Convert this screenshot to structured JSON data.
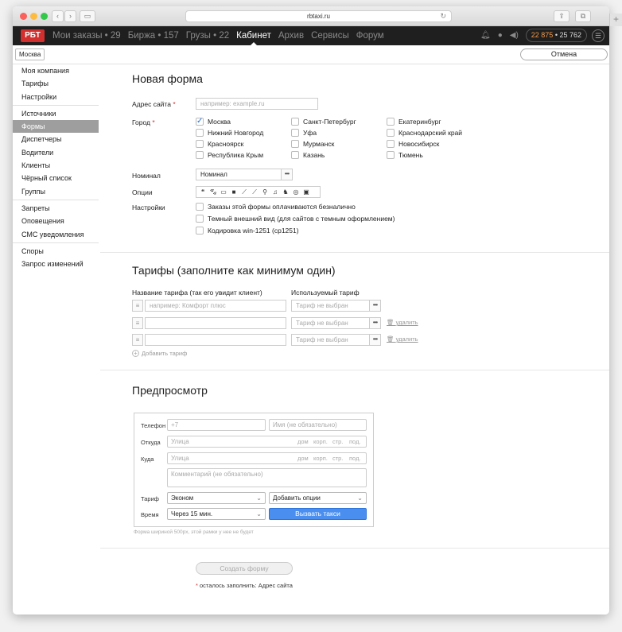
{
  "browser": {
    "url": "rbtaxi.ru",
    "new_tab": "+"
  },
  "topnav": {
    "logo": "РБТ",
    "items": [
      "Мои заказы • 29",
      "Биржа • 157",
      "Грузы • 22",
      "Кабинет",
      "Архив",
      "Сервисы",
      "Форум"
    ],
    "active_index": 3,
    "balance_a": "22 875",
    "balance_sep": " • ",
    "balance_b": "25 762"
  },
  "subbar": {
    "city": "Москва",
    "cancel": "Отмена"
  },
  "sidebar": {
    "group1": [
      "Моя компания",
      "Тарифы",
      "Настройки"
    ],
    "group2": [
      "Источники",
      "Формы",
      "Диспетчеры",
      "Водители",
      "Клиенты",
      "Чёрный список",
      "Группы"
    ],
    "group3": [
      "Запреты",
      "Оповещения",
      "СМС уведомления"
    ],
    "group4": [
      "Споры",
      "Запрос изменений"
    ],
    "active": "Формы"
  },
  "form": {
    "title": "Новая форма",
    "site_label": "Адрес сайта",
    "site_placeholder": "например: example.ru",
    "city_label": "Город",
    "cities": [
      "Москва",
      "Санкт-Петербург",
      "Екатеринбург",
      "Нижний Новгород",
      "Уфа",
      "Краснодарский край",
      "Красноярск",
      "Мурманск",
      "Новосибирск",
      "Республика Крым",
      "Казань",
      "Тюмень"
    ],
    "city_checked": "Москва",
    "nominal_label": "Номинал",
    "nominal_value": "Номинал",
    "options_label": "Опции",
    "settings_label": "Настройки",
    "settings": [
      "Заказы этой формы оплачиваются безналично",
      "Темный внешний вид (для сайтов с темным оформлением)",
      "Кодировка win-1251 (cp1251)"
    ],
    "required_mark": "*"
  },
  "tariffs": {
    "title": "Тарифы (заполните как минимум один)",
    "col_name": "Название тарифа (так его увидит клиент)",
    "col_tariff": "Используемый тариф",
    "name_placeholder": "например: Комфорт плюс",
    "tariff_placeholder": "Тариф не выбран",
    "delete": "удалить",
    "add": "Добавить тариф"
  },
  "preview": {
    "title": "Предпросмотр",
    "phone_label": "Телефон",
    "phone_placeholder": "+7",
    "name_placeholder": "Имя (не обязательно)",
    "from_label": "Откуда",
    "to_label": "Куда",
    "street": "Улица",
    "house": "дом",
    "korp": "корп.",
    "str": "стр.",
    "pod": "под.",
    "comment": "Комментарий (не обязательно)",
    "tariff_label": "Тариф",
    "tariff_value": "Эконом",
    "options_value": "Добавить опции",
    "time_label": "Время",
    "time_value": "Через 15 мин.",
    "call_button": "Вызвать такси",
    "note": "Форма шириной 500px, этой рамки у нее не будет"
  },
  "footer": {
    "create_button": "Создать форму",
    "remaining": "осталось заполнить: Адрес сайта"
  },
  "colors": {
    "brand": "#d32f2f",
    "accent": "#4a8ff0",
    "balance": "#f2994a"
  }
}
